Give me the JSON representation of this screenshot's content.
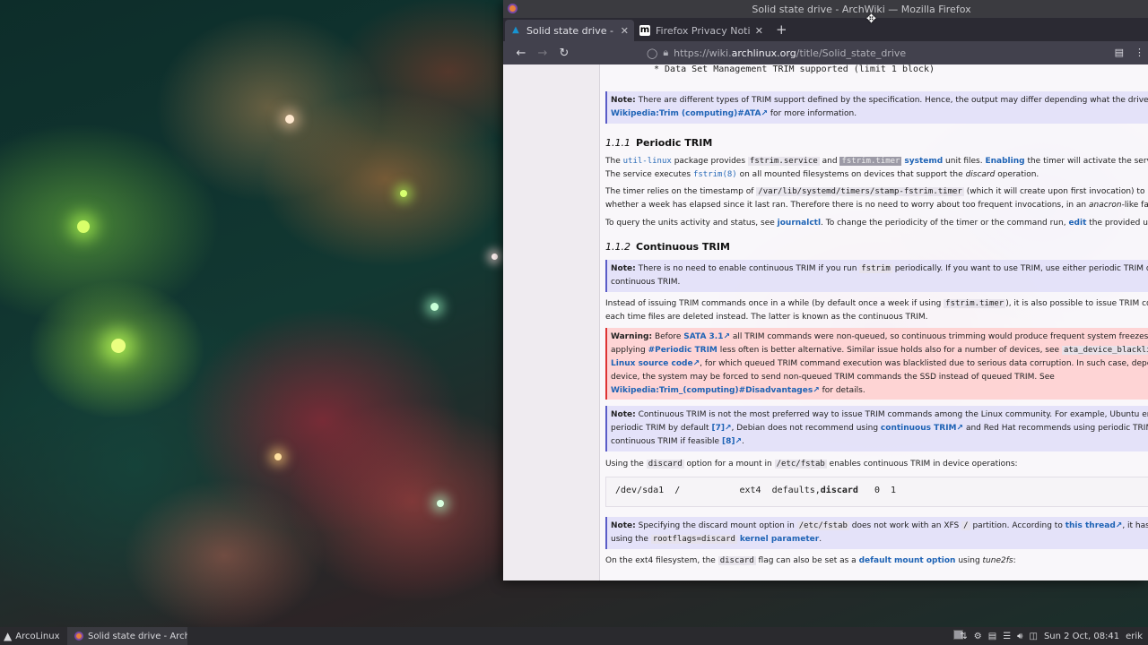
{
  "window": {
    "title": "Solid state drive - ArchWiki — Mozilla Firefox"
  },
  "tabs": [
    {
      "label": "Solid state drive - ArchWi",
      "icon": "arch-favicon",
      "active": true
    },
    {
      "label": "Firefox Privacy Notice —",
      "icon": "mozilla-favicon",
      "active": false
    }
  ],
  "navbar": {
    "url_prefix": "https://wiki.",
    "url_host": "archlinux.org",
    "url_path": "/title/Solid_state_drive"
  },
  "content": {
    "top_code_line": "*    Data Set Management TRIM supported (limit 1 block)",
    "note1": {
      "label": "Note:",
      "text1": "There are different types of TRIM support defined by the specification. Hence, the output may differ depending what the drive supports. S",
      "link": "Wikipedia:Trim (computing)#ATA",
      "text2": "for more information."
    },
    "h_periodic": {
      "num": "1.1.1",
      "title": "Periodic TRIM"
    },
    "p1": {
      "a": "The",
      "util_linux": "util-linux",
      "b": "package provides",
      "c1": "fstrim.service",
      "and": "and",
      "c2": "fstrim.timer",
      "systemd": "systemd",
      "d": "unit files.",
      "enabling": "Enabling",
      "e": "the timer will activate the service we",
      "f": "The service executes",
      "fstrim8": "fstrim(8)",
      "g": "on all mounted filesystems on devices that support the",
      "discard": "discard",
      "h": "operation."
    },
    "p2": {
      "a": "The timer relies on the timestamp of",
      "path": "/var/lib/systemd/timers/stamp-fstrim.timer",
      "b": "(which it will create upon first invocation) to know",
      "c": "whether a week has elapsed since it last ran. Therefore there is no need to worry about too frequent invocations, in an",
      "anacron": "anacron",
      "d": "-like fashion."
    },
    "p3": {
      "a": "To query the units activity and status, see",
      "journalctl": "journalctl",
      "b": ". To change the periodicity of the timer or the command run,",
      "edit": "edit",
      "c": "the provided unit files."
    },
    "h_continuous": {
      "num": "1.1.2",
      "title": "Continuous TRIM"
    },
    "note2": {
      "label": "Note:",
      "a": "There is no need to enable continuous TRIM if you run",
      "fstrim": "fstrim",
      "b": "periodically. If you want to use TRIM, use either periodic TRIM or",
      "c": "continuous TRIM."
    },
    "p4": {
      "a": "Instead of issuing TRIM commands once in a while (by default once a week if using",
      "timer": "fstrim.timer",
      "b": "), it is also possible to issue TRIM commands",
      "c": "each time files are deleted instead. The latter is known as the continuous TRIM."
    },
    "warning": {
      "label": "Warning:",
      "a": "Before",
      "sata": "SATA 3.1",
      "b": "all TRIM commands were non-queued, so continuous trimming would produce frequent system freezes. In this cas",
      "c": "applying",
      "periodic_link": "#Periodic TRIM",
      "d": "less often is better alternative. Similar issue holds also for a number of devices, see",
      "blacklist": "ata_device_blacklist",
      "e": "in",
      "linux_source": "Linux source code",
      "f": ", for which queued TRIM command execution was blacklisted due to serious data corruption. In such case, depending on th",
      "g": "device, the system may be forced to send non-queued TRIM commands the SSD instead of queued TRIM. See",
      "wiki_link": "Wikipedia:Trim_(computing)#Disadvantages",
      "h": "for details."
    },
    "note3": {
      "label": "Note:",
      "a": "Continuous TRIM is not the most preferred way to issue TRIM commands among the Linux community. For example, Ubuntu enables",
      "b": "periodic TRIM by default",
      "ref7": "[7]",
      "c": ", Debian does not recommend using",
      "cont_link": "continuous TRIM",
      "d": "and Red Hat recommends using periodic TRIM over usin",
      "e": "continuous TRIM if feasible",
      "ref8": "[8]",
      "f": "."
    },
    "p5": {
      "a": "Using the",
      "discard": "discard",
      "b": "option for a mount in",
      "fstab": "/etc/fstab",
      "c": "enables continuous TRIM in device operations:"
    },
    "fstab_line": {
      "a": "/dev/sda1  /           ext4  defaults,",
      "b": "discard",
      "c": "   0  1"
    },
    "note4": {
      "label": "Note:",
      "a": "Specifying the discard mount option in",
      "fstab": "/etc/fstab",
      "b": "does not work with an XFS",
      "slash": "/",
      "c": "partition. According to",
      "thread": "this thread",
      "d": ", it has to be set",
      "e": "using the",
      "rootflags": "rootflags=discard",
      "kparam": "kernel parameter",
      "f": "."
    },
    "p6": {
      "a": "On the ext4 filesystem, the",
      "discard": "discard",
      "b": "flag can also be set as a",
      "default_mount": "default mount option",
      "c": "using",
      "tune2fs": "tune2fs",
      "d": ":"
    }
  },
  "taskbar": {
    "start_label": "ArcoLinux",
    "task_label": "Solid state drive - Arch...",
    "clock": "Sun  2 Oct, 08:41",
    "user": "erik"
  }
}
